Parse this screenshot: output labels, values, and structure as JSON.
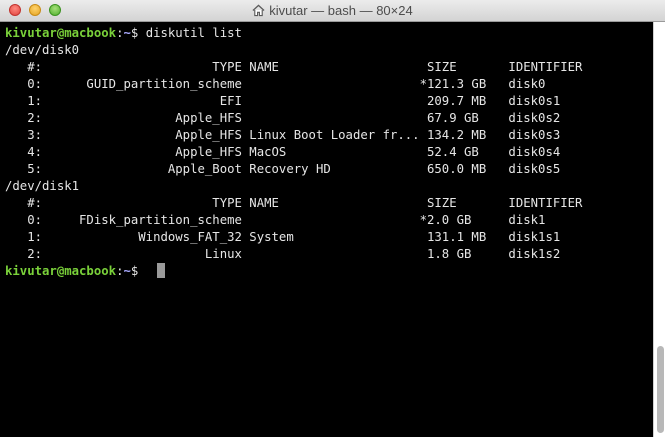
{
  "window": {
    "title": "kivutar — bash — 80×24",
    "title_icon": "home-icon"
  },
  "colors": {
    "prompt_user": "#7ad13a",
    "prompt_path": "#a9a9ff",
    "text": "#e6e6e6",
    "background": "#000000"
  },
  "terminal": {
    "prompt": {
      "user_host": "kivutar@macbook",
      "separator": ":",
      "path": "~",
      "symbol": "$ "
    },
    "command": "diskutil list",
    "disk0": {
      "device": "/dev/disk0",
      "header": "   #:                       TYPE NAME                    SIZE       IDENTIFIER",
      "rows": [
        "   0:      GUID_partition_scheme                        *121.3 GB   disk0",
        "   1:                        EFI                         209.7 MB   disk0s1",
        "   2:                  Apple_HFS                         67.9 GB    disk0s2",
        "   3:                  Apple_HFS Linux Boot Loader fr... 134.2 MB   disk0s3",
        "   4:                  Apple_HFS MacOS                   52.4 GB    disk0s4",
        "   5:                 Apple_Boot Recovery HD             650.0 MB   disk0s5"
      ]
    },
    "disk1": {
      "device": "/dev/disk1",
      "header": "   #:                       TYPE NAME                    SIZE       IDENTIFIER",
      "rows": [
        "   0:     FDisk_partition_scheme                        *2.0 GB     disk1",
        "   1:             Windows_FAT_32 System                  131.1 MB   disk1s1",
        "   2:                      Linux                         1.8 GB     disk1s2"
      ]
    }
  },
  "scrollbar": {
    "thumb_start_fraction": 0.78,
    "thumb_end_fraction": 0.99
  }
}
